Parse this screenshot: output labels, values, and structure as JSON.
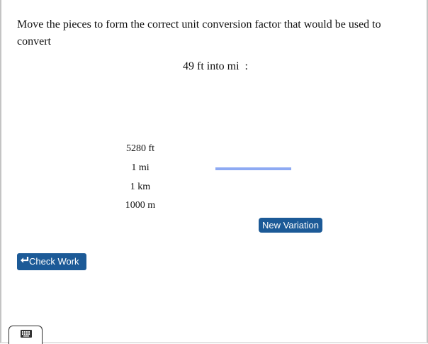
{
  "instruction": "Move the pieces to form the correct unit conversion factor that would be used to convert",
  "problem": "49 ft into mi  :",
  "pieces": [
    "5280 ft",
    "1 mi",
    "1 km",
    "1000 m"
  ],
  "buttons": {
    "new_variation": "New Variation",
    "check_work": "Check Work"
  },
  "icons": {
    "check_work": "return-arrow-icon",
    "keyboard": "keyboard-icon"
  },
  "colors": {
    "button_bg": "#1c5a97",
    "fraction_bar": "#8eaaf3"
  }
}
